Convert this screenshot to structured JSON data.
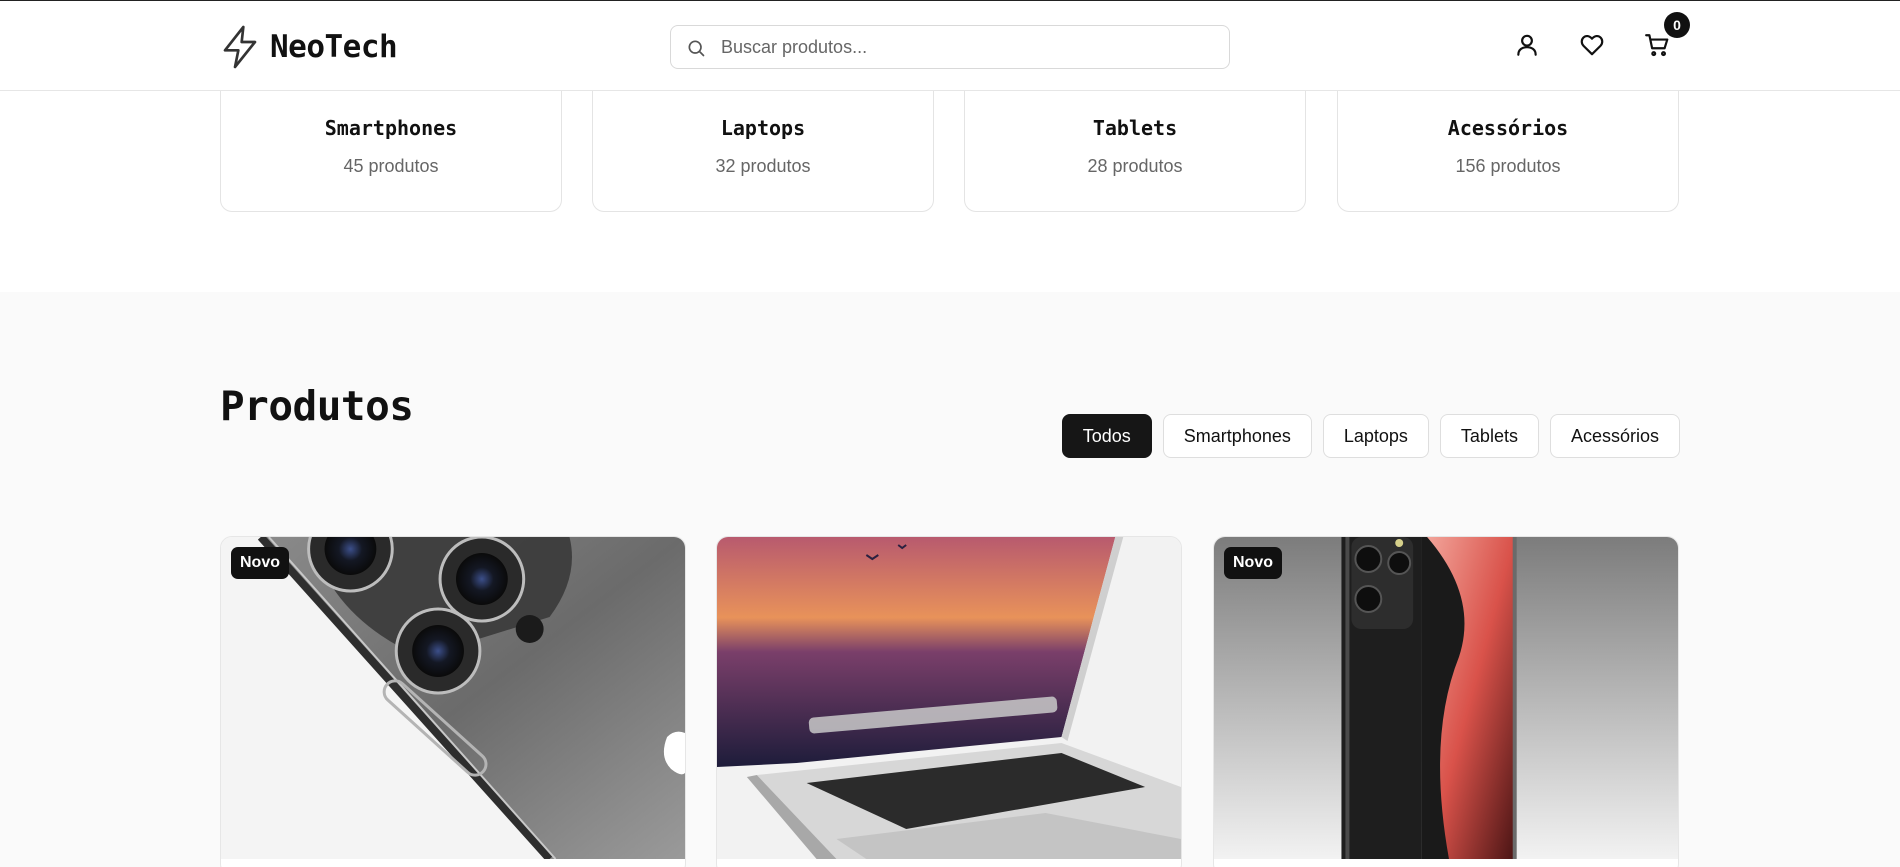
{
  "brand": {
    "name": "NeoTech",
    "logo_icon": "lightning-bolt-icon"
  },
  "search": {
    "placeholder": "Buscar produtos...",
    "icon": "search-icon"
  },
  "header_actions": {
    "account_icon": "user-icon",
    "wishlist_icon": "heart-icon",
    "cart_icon": "cart-icon",
    "cart_count": "0"
  },
  "categories": [
    {
      "name": "Smartphones",
      "count": "45 produtos"
    },
    {
      "name": "Laptops",
      "count": "32 produtos"
    },
    {
      "name": "Tablets",
      "count": "28 produtos"
    },
    {
      "name": "Acessórios",
      "count": "156 produtos"
    }
  ],
  "products_section": {
    "title": "Produtos",
    "filters": [
      {
        "label": "Todos",
        "active": true
      },
      {
        "label": "Smartphones",
        "active": false
      },
      {
        "label": "Laptops",
        "active": false
      },
      {
        "label": "Tablets",
        "active": false
      },
      {
        "label": "Acessórios",
        "active": false
      }
    ],
    "items": [
      {
        "badge": "Novo",
        "image": "iphone-pro-camera-photo"
      },
      {
        "badge": "",
        "image": "macbook-laptop-photo"
      },
      {
        "badge": "Novo",
        "image": "galaxy-s21-ultra-photo"
      }
    ]
  },
  "colors": {
    "accent": "#161616",
    "section_bg": "#fafafa",
    "muted_text": "#666666"
  }
}
